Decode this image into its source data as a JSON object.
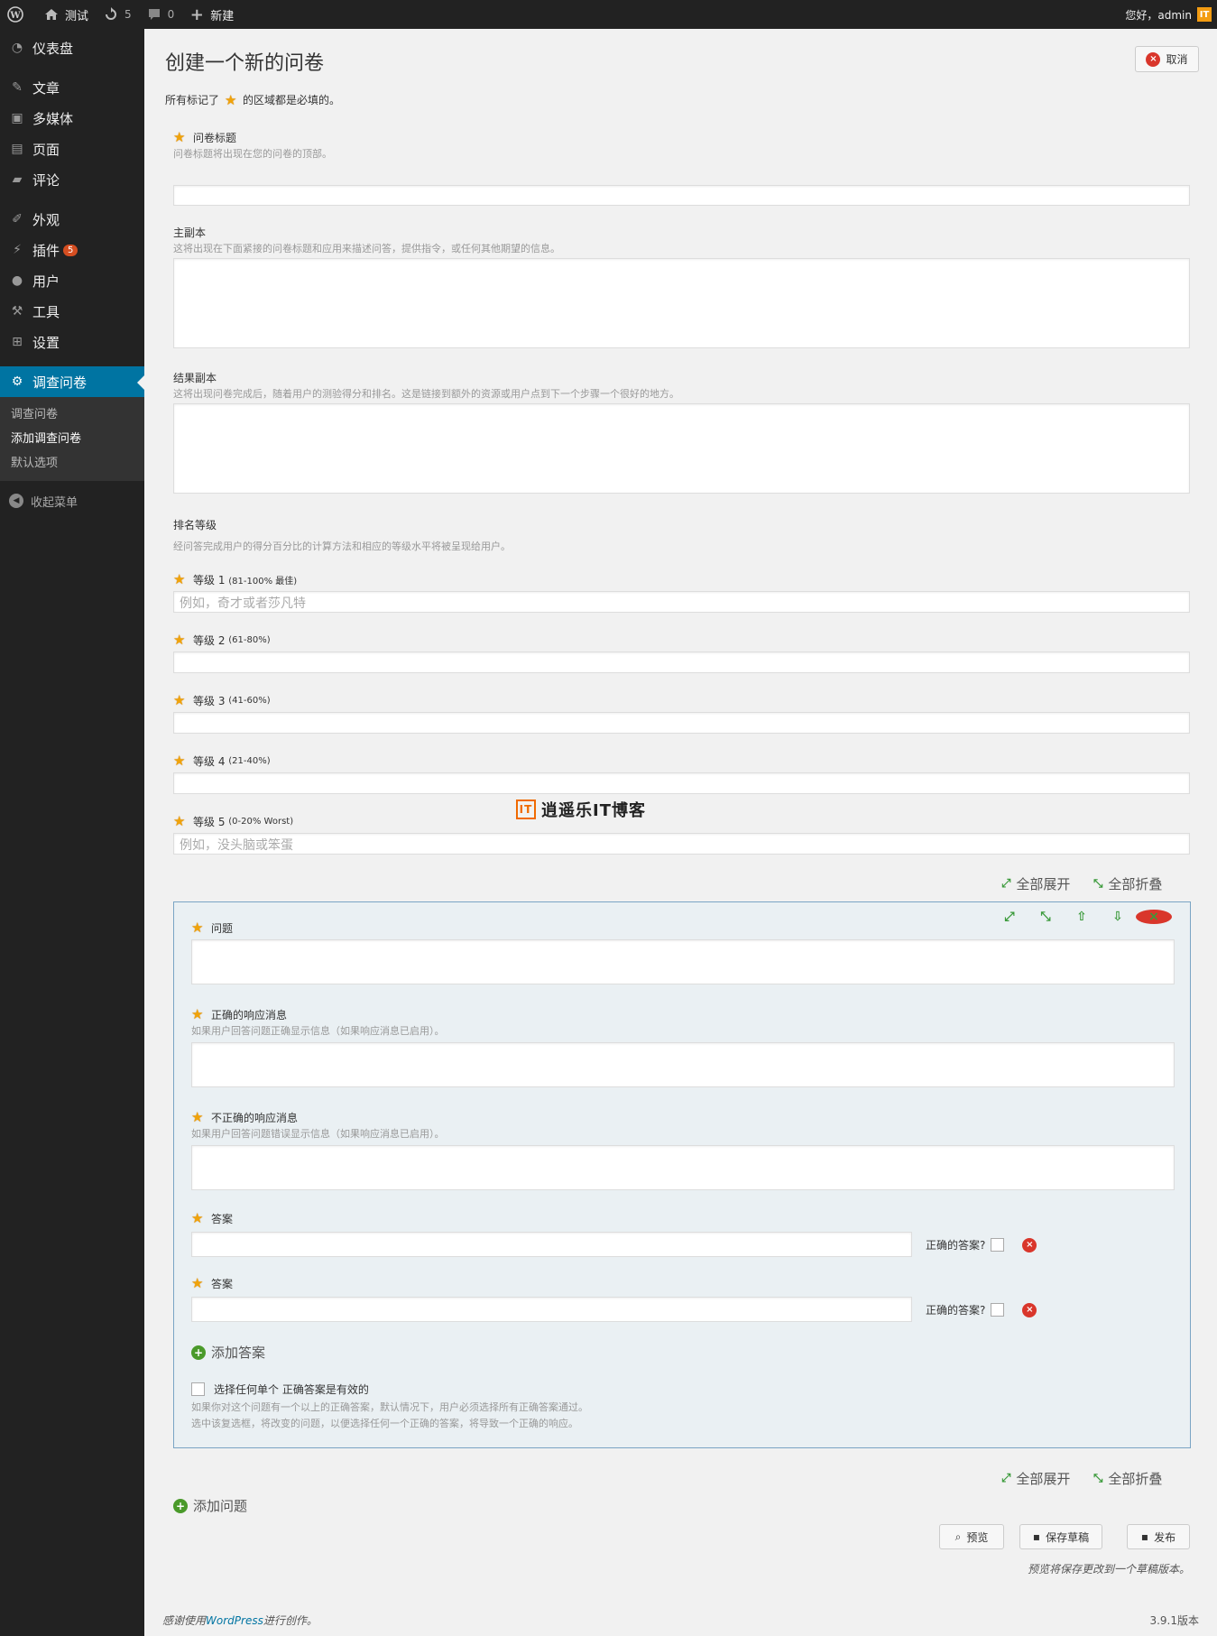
{
  "adminbar": {
    "site_name": "测试",
    "updates_count": "5",
    "comments_count": "0",
    "new_label": "新建",
    "greeting": "您好，admin"
  },
  "sidebar": {
    "items": [
      {
        "label": "仪表盘",
        "icon": "dashboard-icon"
      },
      {
        "label": "文章",
        "icon": "pin-icon"
      },
      {
        "label": "多媒体",
        "icon": "media-icon"
      },
      {
        "label": "页面",
        "icon": "page-icon"
      },
      {
        "label": "评论",
        "icon": "comment-icon"
      },
      {
        "label": "外观",
        "icon": "appearance-icon"
      },
      {
        "label": "插件",
        "icon": "plugin-icon",
        "badge": "5"
      },
      {
        "label": "用户",
        "icon": "user-icon"
      },
      {
        "label": "工具",
        "icon": "wrench-icon"
      },
      {
        "label": "设置",
        "icon": "settings-icon"
      },
      {
        "label": "调查问卷",
        "icon": "gear-icon"
      }
    ],
    "submenu": [
      "调查问卷",
      "添加调查问卷",
      "默认选项"
    ],
    "collapse_label": "收起菜单"
  },
  "main": {
    "title": "创建一个新的问卷",
    "cancel_label": "取消",
    "required_note_before": "所有标记了",
    "required_note_after": "的区域都是必填的。",
    "quiz_title": {
      "label": "问卷标题",
      "desc": "问卷标题将出现在您的问卷的顶部。",
      "value": ""
    },
    "main_copy": {
      "label": "主副本",
      "desc": "这将出现在下面紧接的问卷标题和应用来描述问答，提供指令，或任何其他期望的信息。"
    },
    "result_copy": {
      "label": "结果副本",
      "desc": "这将出现问卷完成后，随着用户的测验得分和排名。这是链接到额外的资源或用户点到下一个步骤一个很好的地方。"
    },
    "ranking": {
      "label": "排名等级",
      "desc": "经问答完成用户的得分百分比的计算方法和相应的等级水平将被呈现给用户。",
      "levels": [
        {
          "label": "等级 1",
          "range": "(81-100% 最佳)",
          "placeholder": "例如，奇才或者莎凡特"
        },
        {
          "label": "等级 2",
          "range": "(61-80%)",
          "placeholder": ""
        },
        {
          "label": "等级 3",
          "range": "(41-60%)",
          "placeholder": ""
        },
        {
          "label": "等级 4",
          "range": "(21-40%)",
          "placeholder": ""
        },
        {
          "label": "等级 5",
          "range": "(0-20% Worst)",
          "placeholder": "例如，没头脑或笨蛋"
        }
      ]
    },
    "expand_all": "全部展开",
    "collapse_all": "全部折叠",
    "question": {
      "label": "问题",
      "correct_label": "正确的响应消息",
      "correct_desc": "如果用户回答问题正确显示信息（如果响应消息已启用）。",
      "incorrect_label": "不正确的响应消息",
      "incorrect_desc": "如果用户回答问题错误显示信息（如果响应消息已启用）。",
      "answers": [
        {
          "label": "答案",
          "correct_label": "正确的答案?"
        },
        {
          "label": "答案",
          "correct_label": "正确的答案?"
        }
      ],
      "add_answer": "添加答案",
      "any_correct_label": "选择任何单个 正确答案是有效的",
      "any_correct_desc1": "如果你对这个问题有一个以上的正确答案，默认情况下，用户必须选择所有正确答案通过。",
      "any_correct_desc2": "选中该复选框，将改变的问题，以便选择任何一个正确的答案，将导致一个正确的响应。"
    },
    "add_question": "添加问题",
    "preview_label": "预览",
    "save_draft_label": "保存草稿",
    "publish_label": "发布",
    "save_note": "预览将保存更改到一个草稿版本。",
    "watermark": "逍遥乐IT博客"
  },
  "footer": {
    "thanks_before": "感谢使用",
    "thanks_link": "WordPress",
    "thanks_after": "进行创作。",
    "version": "3.9.1版本"
  },
  "colors": {
    "accent": "#0074a2",
    "star": "#f0a30a",
    "danger": "#d9362b",
    "success": "#4a9a2a"
  }
}
